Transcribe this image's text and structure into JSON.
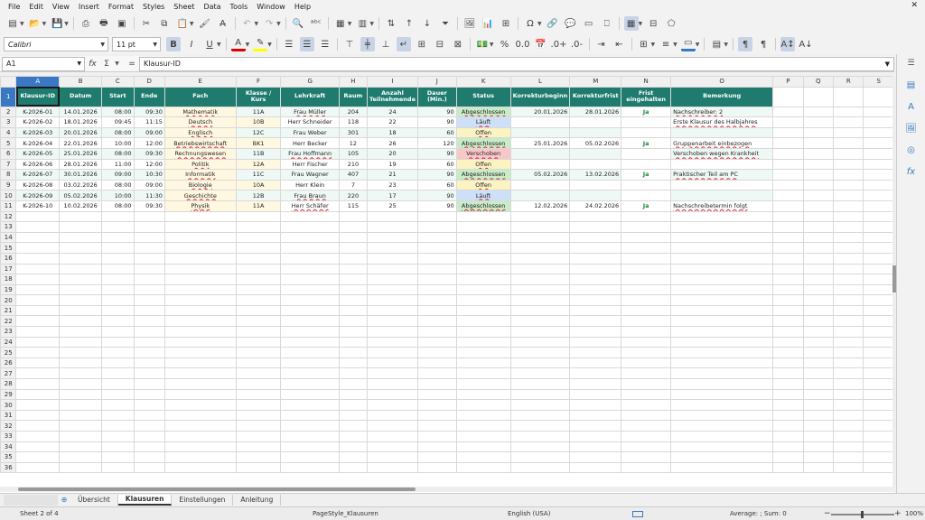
{
  "menu": [
    "File",
    "Edit",
    "View",
    "Insert",
    "Format",
    "Styles",
    "Sheet",
    "Data",
    "Tools",
    "Window",
    "Help"
  ],
  "close_glyph": "✕",
  "font": {
    "name": "Calibri",
    "size": "11 pt"
  },
  "namebox": "A1",
  "formula": "Klausur-ID",
  "columns": [
    "A",
    "B",
    "C",
    "D",
    "E",
    "F",
    "G",
    "H",
    "I",
    "J",
    "K",
    "L",
    "M",
    "N",
    "O",
    "P",
    "Q",
    "R",
    "S"
  ],
  "headers": [
    "Klausur-ID",
    "Datum",
    "Start",
    "Ende",
    "Fach",
    "Klasse / Kurs",
    "Lehrkraft",
    "Raum",
    "Anzahl Teilnehmende",
    "Dauer (Min.)",
    "Status",
    "Korrekturbeginn",
    "Korrekturfrist",
    "Frist eingehalten",
    "Bemerkung"
  ],
  "rows": [
    [
      "K-2026-01",
      "14.01.2026",
      "08:00",
      "09:30",
      "Mathematik",
      "11A",
      "Frau Müller",
      "204",
      "24",
      "90",
      "Abgeschlossen",
      "20.01.2026",
      "28.01.2026",
      "Ja",
      "Nachschreiber: 2"
    ],
    [
      "K-2026-02",
      "18.01.2026",
      "09:45",
      "11:15",
      "Deutsch",
      "10B",
      "Herr Schneider",
      "118",
      "22",
      "90",
      "Läuft",
      "",
      "",
      "",
      "Erste Klausur des Halbjahres"
    ],
    [
      "K-2026-03",
      "20.01.2026",
      "08:00",
      "09:00",
      "Englisch",
      "12C",
      "Frau Weber",
      "301",
      "18",
      "60",
      "Offen",
      "",
      "",
      "",
      ""
    ],
    [
      "K-2026-04",
      "22.01.2026",
      "10:00",
      "12:00",
      "Betriebswirtschaft",
      "BK1",
      "Herr Becker",
      "12",
      "26",
      "120",
      "Abgeschlossen",
      "25.01.2026",
      "05.02.2026",
      "Ja",
      "Gruppenarbeit einbezogen"
    ],
    [
      "K-2026-05",
      "25.01.2026",
      "08:00",
      "09:30",
      "Rechnungswesen",
      "11B",
      "Frau Hoffmann",
      "105",
      "20",
      "90",
      "Verschoben",
      "",
      "",
      "",
      "Verschoben wegen Krankheit"
    ],
    [
      "K-2026-06",
      "28.01.2026",
      "11:00",
      "12:00",
      "Politik",
      "12A",
      "Herr Fischer",
      "210",
      "19",
      "60",
      "Offen",
      "",
      "",
      "",
      ""
    ],
    [
      "K-2026-07",
      "30.01.2026",
      "09:00",
      "10:30",
      "Informatik",
      "11C",
      "Frau Wagner",
      "407",
      "21",
      "90",
      "Abgeschlossen",
      "05.02.2026",
      "13.02.2026",
      "Ja",
      "Praktischer Teil am PC"
    ],
    [
      "K-2026-08",
      "03.02.2026",
      "08:00",
      "09:00",
      "Biologie",
      "10A",
      "Herr Klein",
      "7",
      "23",
      "60",
      "Offen",
      "",
      "",
      "",
      ""
    ],
    [
      "K-2026-09",
      "05.02.2026",
      "10:00",
      "11:30",
      "Geschichte",
      "12B",
      "Frau Braun",
      "220",
      "17",
      "90",
      "Läuft",
      "",
      "",
      "",
      ""
    ],
    [
      "K-2026-10",
      "10.02.2026",
      "08:00",
      "09:30",
      "Physik",
      "11A",
      "Herr Schäfer",
      "115",
      "25",
      "90",
      "Abgeschlossen",
      "12.02.2026",
      "24.02.2026",
      "Ja",
      "Nachschreibetermin folgt"
    ]
  ],
  "tabs": [
    "Übersicht",
    "Klausuren",
    "Einstellungen",
    "Anleitung"
  ],
  "active_tab": "Klausuren",
  "status": {
    "sheet": "Sheet 2 of 4",
    "page_style": "PageStyle_Klausuren",
    "language": "English (USA)",
    "summary": "Average: ; Sum: 0",
    "zoom": "100%"
  },
  "colors": {
    "header_bg": "#1e7b6e",
    "abgeschlossen": "#c8ebc8",
    "laeuft": "#cde0f7",
    "offen": "#fbf3c2",
    "verschoben": "#f8c8c8",
    "selection": "#3a78c4"
  }
}
